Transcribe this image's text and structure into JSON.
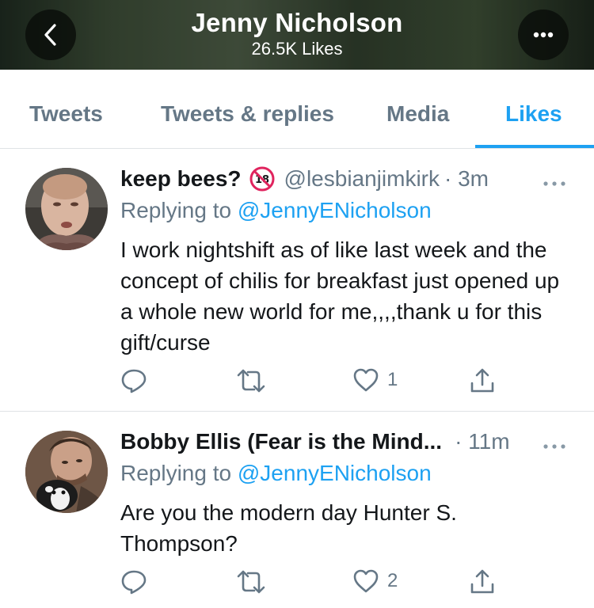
{
  "header": {
    "title": "Jenny Nicholson",
    "subtitle": "26.5K Likes",
    "back_icon": "chevron-left-icon",
    "more_icon": "more-horizontal-icon"
  },
  "tabs": [
    {
      "label": "Tweets",
      "active": false
    },
    {
      "label": "Tweets & replies",
      "active": false
    },
    {
      "label": "Media",
      "active": false
    },
    {
      "label": "Likes",
      "active": true
    }
  ],
  "colors": {
    "accent": "#1da1f2",
    "secondary_text": "#657786",
    "primary_text": "#14171a"
  },
  "tweets": [
    {
      "display_name": "keep bees?",
      "emoji": "🔞",
      "handle": "@lesbianjimkirk",
      "time": "· 3m",
      "replying_prefix": "Replying to ",
      "replying_to": "@JennyENicholson",
      "text": "I work nightshift as of like last week and the concept of chilis for breakfast just opened up a whole new world for me,,,,thank u for this gift/curse",
      "likes": "1"
    },
    {
      "display_name": "Bobby Ellis (Fear is the Mind...",
      "handle": "",
      "time": "· 11m",
      "replying_prefix": "Replying to ",
      "replying_to": "@JennyENicholson",
      "text": "Are you the modern day Hunter S. Thompson?",
      "likes": "2"
    }
  ]
}
